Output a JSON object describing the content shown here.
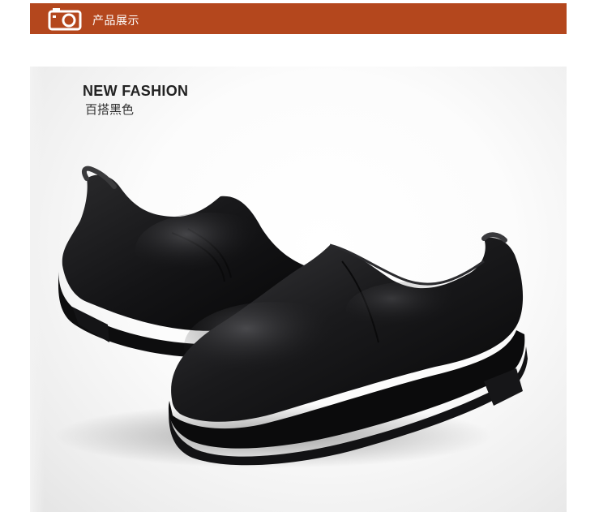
{
  "header": {
    "icon": "camera-icon",
    "title": "产品展示",
    "bar_color": "#b4471d"
  },
  "product": {
    "heading": "NEW FASHION",
    "subheading": "百搭黑色",
    "image": "black-leather-slip-on-shoes"
  }
}
